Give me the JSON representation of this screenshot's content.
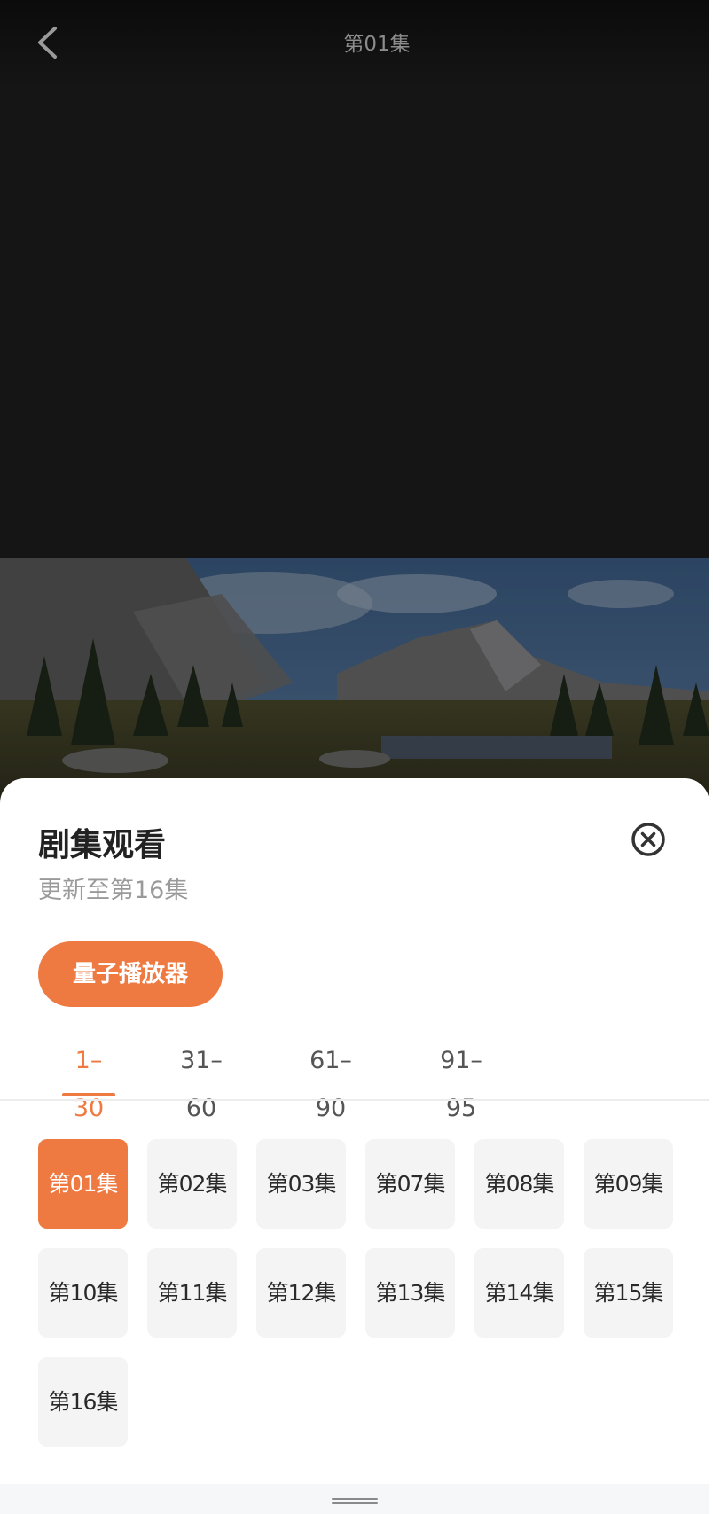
{
  "video": {
    "title": "第01集"
  },
  "sheet": {
    "title": "剧集观看",
    "subtitle": "更新至第16集",
    "player_label": "量子播放器",
    "range_tabs": [
      "1–30",
      "31–60",
      "61–90",
      "91–95"
    ],
    "active_range_tab": 0,
    "episodes": [
      "第01集",
      "第02集",
      "第03集",
      "第07集",
      "第08集",
      "第09集",
      "第10集",
      "第11集",
      "第12集",
      "第13集",
      "第14集",
      "第15集",
      "第16集"
    ],
    "active_episode": 0
  },
  "icons": {
    "back": "chevron-left-icon",
    "close": "close-circle-icon",
    "handle": "drag-handle-icon"
  },
  "colors": {
    "accent": "#ee7a42",
    "sheet_bg": "#ffffff",
    "tile_bg": "#f4f4f4",
    "video_bg": "#151515"
  }
}
